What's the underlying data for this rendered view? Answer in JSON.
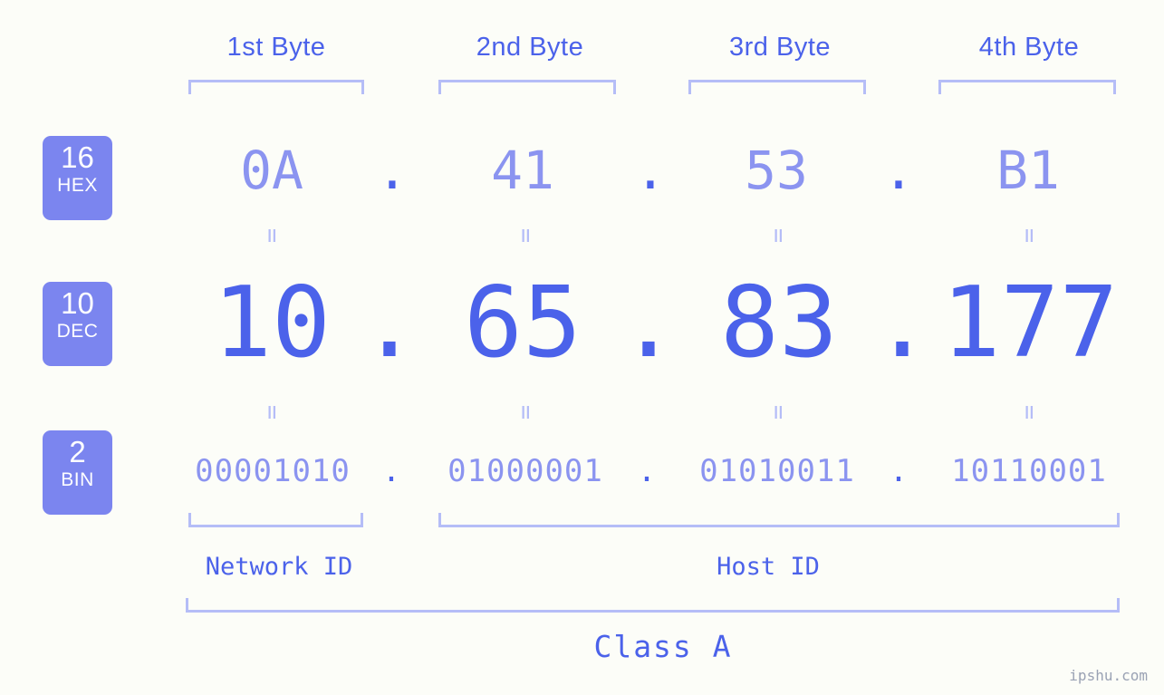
{
  "watermark": "ipshu.com",
  "byte_headers": [
    {
      "label": "1st Byte"
    },
    {
      "label": "2nd Byte"
    },
    {
      "label": "3rd Byte"
    },
    {
      "label": "4th Byte"
    }
  ],
  "bases": [
    {
      "number": "16",
      "name": "HEX"
    },
    {
      "number": "10",
      "name": "DEC"
    },
    {
      "number": "2",
      "name": "BIN"
    }
  ],
  "separator": ".",
  "equals": "=",
  "rows": {
    "hex": {
      "base_number": "16",
      "base_name": "HEX",
      "values": [
        "0A",
        "41",
        "53",
        "B1"
      ]
    },
    "dec": {
      "base_number": "10",
      "base_name": "DEC",
      "values": [
        "10",
        "65",
        "83",
        "177"
      ]
    },
    "bin": {
      "base_number": "2",
      "base_name": "BIN",
      "values": [
        "00001010",
        "01000001",
        "01010011",
        "10110001"
      ]
    }
  },
  "address": {
    "hex": "0A.41.53.B1",
    "dec": "10.65.83.177",
    "bin": "00001010.01000001.01010011.10110001"
  },
  "segments": {
    "network_id": "Network ID",
    "host_id": "Host ID",
    "class": "Class A"
  },
  "colors": {
    "background": "#fcfdf8",
    "accent_strong": "#4b62ea",
    "accent_light": "#8b94f0",
    "bracket": "#b5bdf7",
    "badge_bg": "#7b85ef",
    "badge_text": "#ffffff",
    "watermark": "#9aa2b4"
  }
}
